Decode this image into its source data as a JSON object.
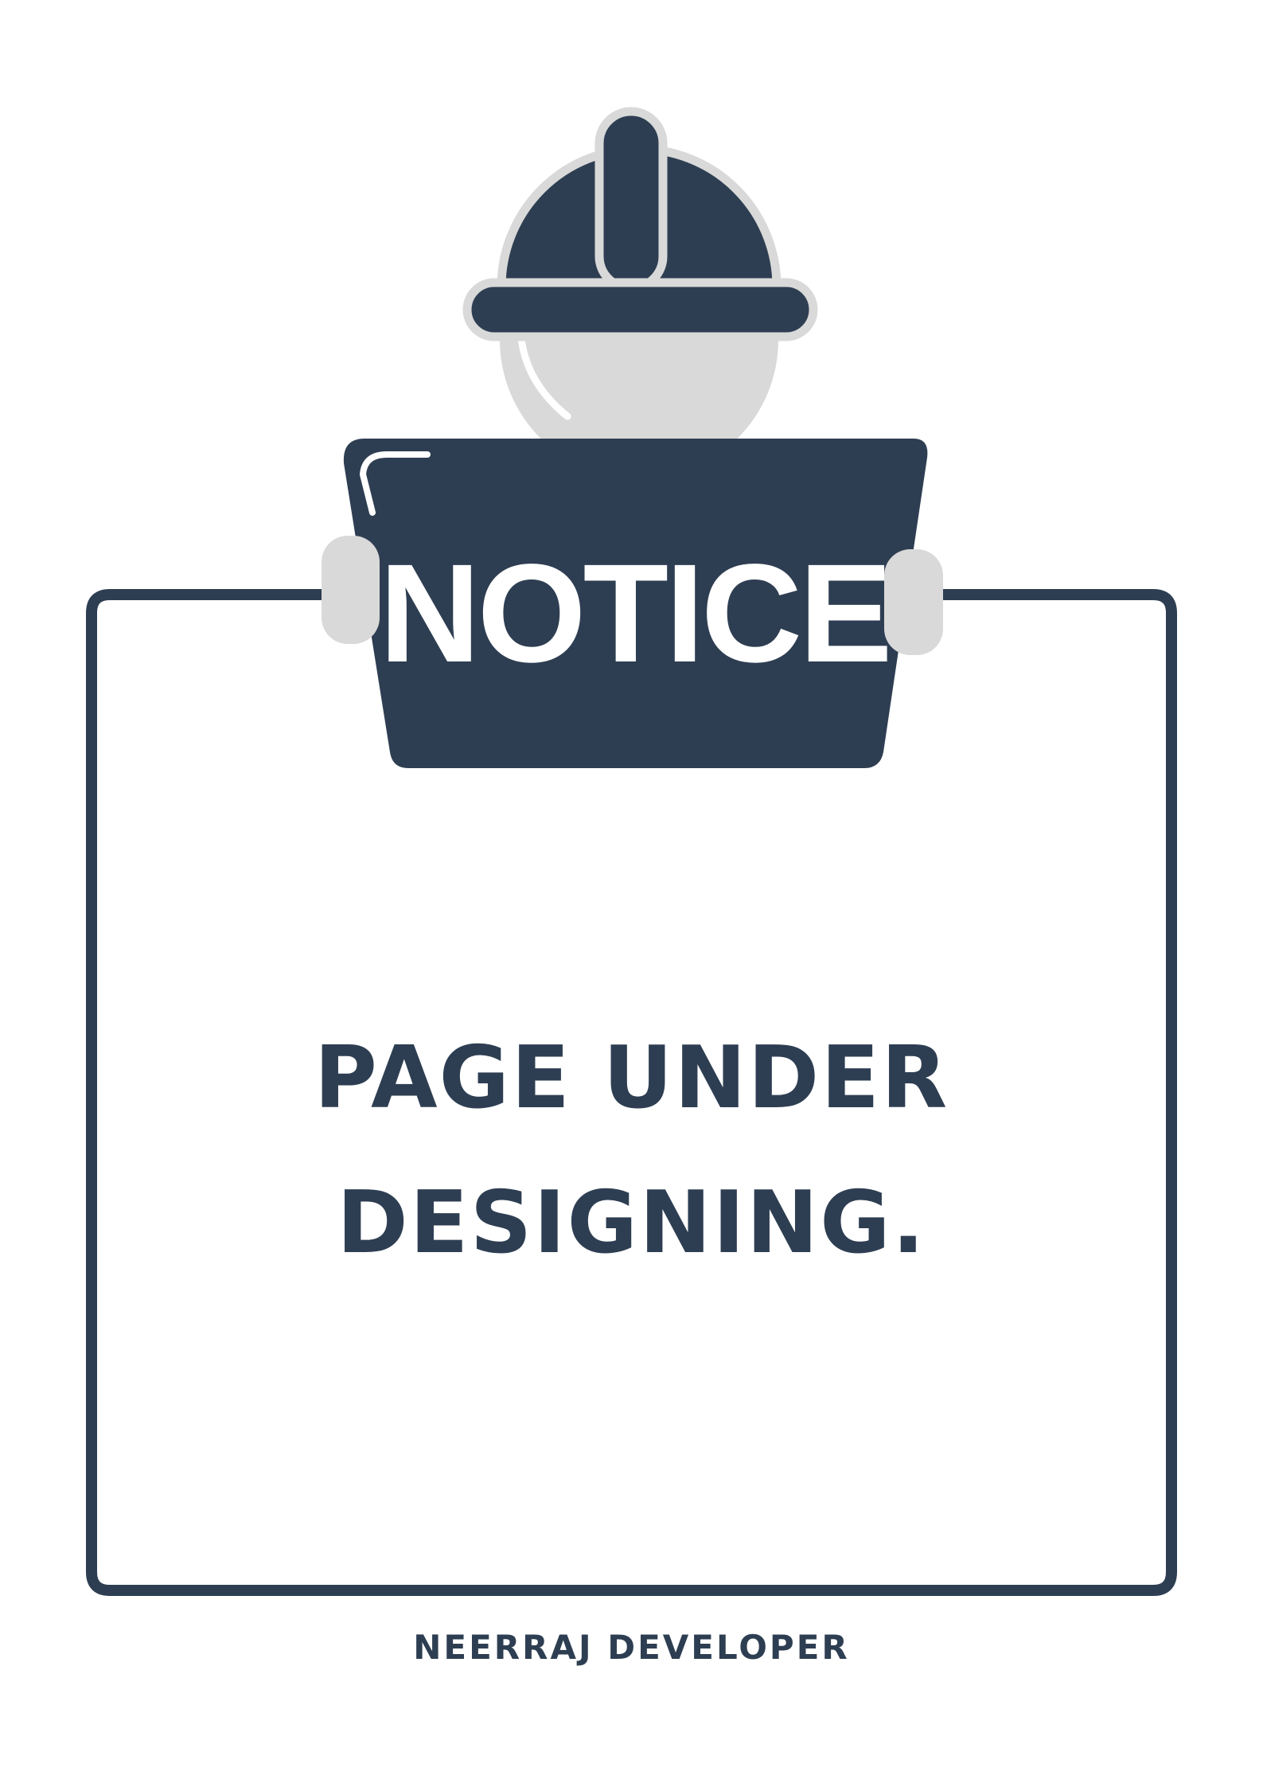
{
  "colors": {
    "primary": "#2e3e52",
    "accent_gray": "#d9d9d9",
    "background": "#ffffff"
  },
  "sign": {
    "label": "NOTICE"
  },
  "message": {
    "line_1": "PAGE UNDER",
    "line_2": "DESIGNING."
  },
  "footer": {
    "credit": "NEERRAJ DEVELOPER"
  },
  "icons": {
    "worker": "construction-worker-icon",
    "helmet": "hard-hat-icon"
  }
}
